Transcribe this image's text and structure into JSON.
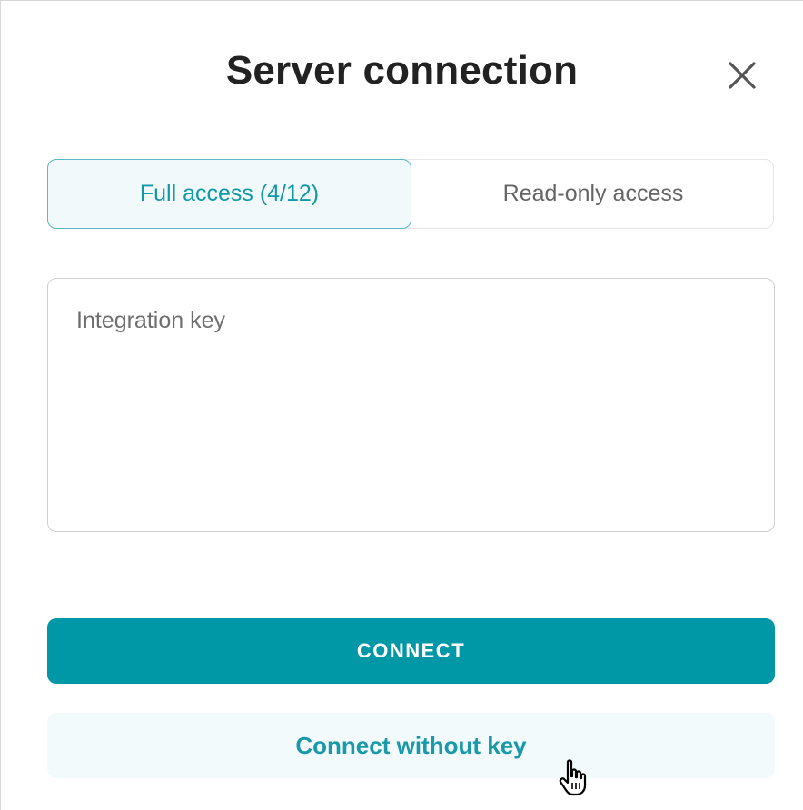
{
  "dialog": {
    "title": "Server connection"
  },
  "tabs": [
    {
      "label": "Full access (4/12)",
      "selected": true
    },
    {
      "label": "Read-only access",
      "selected": false
    }
  ],
  "key_input": {
    "placeholder": "Integration key",
    "value": ""
  },
  "buttons": {
    "connect_label": "CONNECT",
    "connect_without_key_label": "Connect without key"
  },
  "colors": {
    "accent": "#0097a7",
    "selected_tab_bg": "#f1f9fb",
    "secondary_button_bg": "#f3fafc"
  },
  "icons": {
    "close": "close-icon",
    "cursor": "hand-pointer-icon"
  }
}
